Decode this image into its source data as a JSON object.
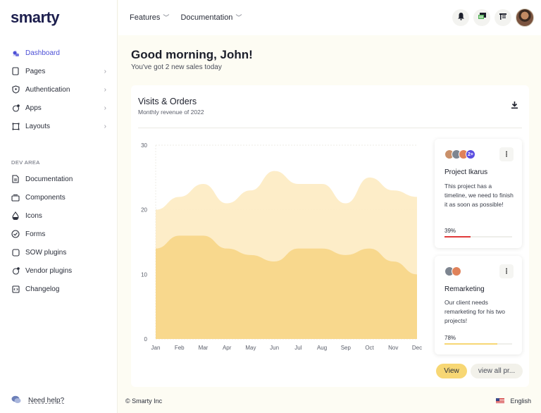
{
  "app": {
    "logo": "smarty"
  },
  "sidebar": {
    "items": [
      {
        "label": "Dashboard",
        "icon": "dashboard-icon",
        "active": true,
        "chevron": false
      },
      {
        "label": "Pages",
        "icon": "page-icon",
        "chevron": true
      },
      {
        "label": "Authentication",
        "icon": "shield-icon",
        "chevron": true
      },
      {
        "label": "Apps",
        "icon": "apps-icon",
        "chevron": true
      },
      {
        "label": "Layouts",
        "icon": "layout-icon",
        "chevron": true
      }
    ],
    "section_label": "DEV AREA",
    "dev_items": [
      {
        "label": "Documentation",
        "icon": "document-icon"
      },
      {
        "label": "Components",
        "icon": "components-icon"
      },
      {
        "label": "Icons",
        "icon": "droplet-icon"
      },
      {
        "label": "Forms",
        "icon": "check-circle-icon"
      },
      {
        "label": "SOW plugins",
        "icon": "plugin-icon"
      },
      {
        "label": "Vendor plugins",
        "icon": "vendor-icon"
      },
      {
        "label": "Changelog",
        "icon": "code-icon"
      }
    ],
    "help": "Need help?"
  },
  "topbar": {
    "menu": [
      {
        "label": "Features"
      },
      {
        "label": "Documentation"
      }
    ],
    "icons": [
      "bell-icon",
      "message-icon",
      "calendar-icon"
    ]
  },
  "greeting": {
    "title": "Good morning, John!",
    "subtitle": "You've got 2 new sales today"
  },
  "card": {
    "title": "Visits & Orders",
    "subtitle": "Monthly revenue of 2022"
  },
  "colors": {
    "visits": "#fdebc2",
    "orders": "#f8d78a",
    "accent": "#f7d774",
    "purple": "#5b4de0"
  },
  "chart_data": {
    "type": "area",
    "x": [
      "Jan",
      "Feb",
      "Mar",
      "Apr",
      "May",
      "Jun",
      "Jul",
      "Aug",
      "Sep",
      "Oct",
      "Nov",
      "Dec"
    ],
    "ylim": [
      0,
      30
    ],
    "yticks": [
      0,
      10,
      20,
      30
    ],
    "grid": true,
    "series": [
      {
        "values": [
          20,
          22,
          24,
          21,
          23,
          26,
          24,
          24,
          21,
          25,
          23,
          22
        ]
      },
      {
        "values": [
          14,
          16,
          16,
          14,
          13,
          12,
          14,
          14,
          13,
          14,
          12,
          10
        ]
      }
    ]
  },
  "projects": [
    {
      "title": "Project Ikarus",
      "description": "This project has a timeline, we need to finish it as soon as possible!",
      "progress_label": "39%",
      "progress": 0.39,
      "bar_color": "#e03b3b",
      "extra_members": "2+"
    },
    {
      "title": "Remarketing",
      "description": "Our client needs remarketing for his two projects!",
      "progress_label": "78%",
      "progress": 0.78,
      "bar_color": "#f7d774"
    }
  ],
  "actions": {
    "view": "View",
    "view_all": "view all pr..."
  },
  "footer": {
    "copyright": "© Smarty Inc",
    "language": "English"
  }
}
